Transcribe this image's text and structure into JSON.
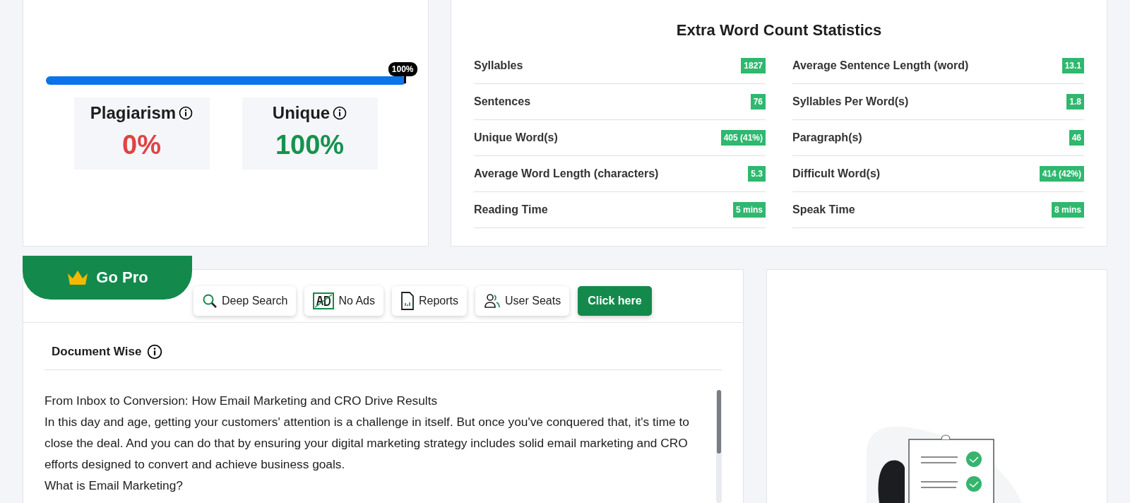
{
  "score": {
    "label": "100%",
    "level": 1
  },
  "metrics": [
    {
      "kind": "plagiarism",
      "label": "Plagiarism",
      "value": "0%"
    },
    {
      "kind": "unique",
      "label": "Unique",
      "value": "100%"
    }
  ],
  "stats": {
    "title": "Extra Word Count Statistics",
    "items": [
      {
        "label": "Syllables",
        "value": "1827"
      },
      {
        "label": "Average Sentence Length (word)",
        "value": "13.1"
      },
      {
        "label": "Sentences",
        "value": "76"
      },
      {
        "label": "Syllables Per Word(s)",
        "value": "1.8"
      },
      {
        "label": "Unique Word(s)",
        "value": "405 (41%)"
      },
      {
        "label": "Paragraph(s)",
        "value": "46"
      },
      {
        "label": "Average Word Length (characters)",
        "value": "5.3"
      },
      {
        "label": "Difficult Word(s)",
        "value": "414 (42%)"
      },
      {
        "label": "Reading Time",
        "value": "5 mins"
      },
      {
        "label": "Speak Time",
        "value": "8 mins"
      }
    ]
  },
  "promo": {
    "label": "Go Pro",
    "features": [
      {
        "kind": "search",
        "label": "Deep Search"
      },
      {
        "kind": "ads",
        "label": "No Ads"
      },
      {
        "kind": "reports",
        "label": "Reports"
      },
      {
        "kind": "seats",
        "label": "User Seats"
      }
    ],
    "cta": "Click here"
  },
  "document": {
    "heading": "Document Wise",
    "paragraphs": [
      "From Inbox to Conversion: How Email Marketing and CRO Drive Results",
      "In this day and age, getting your customers' attention is a challenge in itself. But once you've conquered that, it's time to close the deal. And you can do that by ensuring your digital marketing strategy includes solid email marketing and CRO efforts designed to convert and achieve business goals.",
      "What is Email Marketing?"
    ]
  }
}
